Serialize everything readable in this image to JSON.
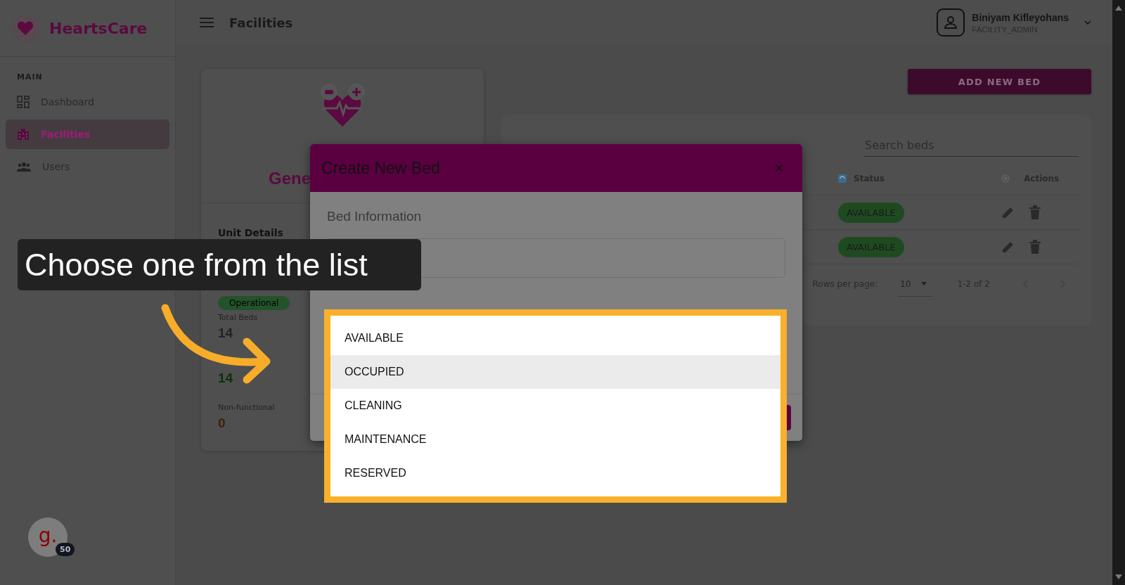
{
  "sidebar": {
    "brand": "HeartsCare",
    "section": "MAIN",
    "items": [
      {
        "label": "Dashboard",
        "selected": false
      },
      {
        "label": "Facilities",
        "selected": true
      },
      {
        "label": "Users",
        "selected": false
      }
    ]
  },
  "header": {
    "title": "Facilities",
    "user": {
      "name": "Biniyam Kifleyohans",
      "role": "FACILITY_ADMIN"
    }
  },
  "unit_card": {
    "title": "Gene",
    "heading": "Unit Details",
    "status_badge": "Operational",
    "stats": [
      {
        "label": "Total Beds",
        "value": "14",
        "kind": "total"
      },
      {
        "value": "14",
        "kind": "available"
      },
      {
        "label": "Non-functional",
        "value": "0",
        "kind": "nonfunctional"
      }
    ]
  },
  "add_button": "ADD NEW BED",
  "beds_table": {
    "search_placeholder": "Search beds",
    "columns": [
      "Status",
      "Actions"
    ],
    "rows": [
      {
        "status": "AVAILABLE"
      },
      {
        "status": "AVAILABLE"
      }
    ],
    "rows_per_page_label": "Rows per page:",
    "rows_per_page": "10",
    "range": "1-2 of 2"
  },
  "modal": {
    "title": "Create New Bed",
    "section": "Bed Information"
  },
  "dropdown": {
    "options": [
      {
        "label": "AVAILABLE",
        "highlighted": false
      },
      {
        "label": "OCCUPIED",
        "highlighted": true
      },
      {
        "label": "CLEANING",
        "highlighted": false
      },
      {
        "label": "MAINTENANCE",
        "highlighted": false
      },
      {
        "label": "RESERVED",
        "highlighted": false
      }
    ]
  },
  "tooltip": {
    "text": "Choose one from the list"
  },
  "widget": {
    "letter": "g.",
    "badge": "50"
  }
}
